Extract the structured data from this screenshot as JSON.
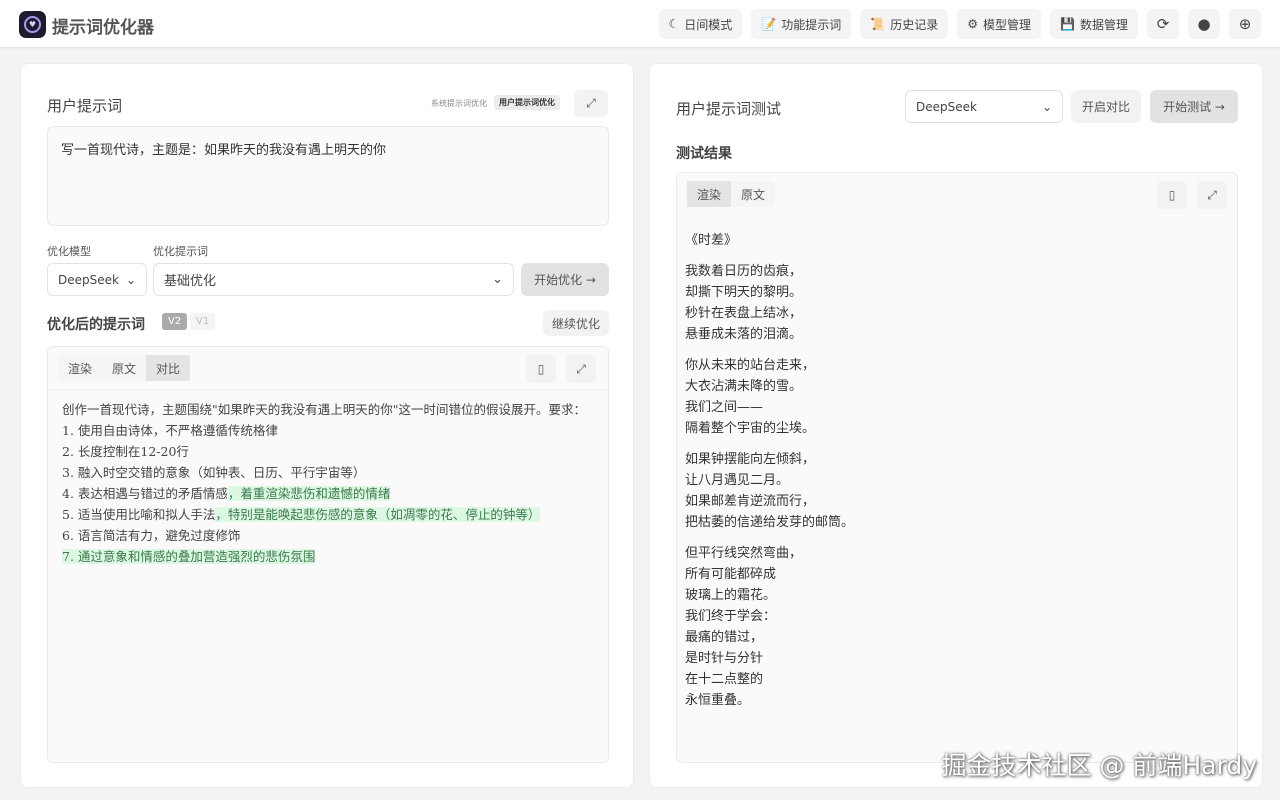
{
  "header": {
    "title": "提示词优化器",
    "nav": [
      {
        "icon": "moon-icon",
        "glyph": "☾",
        "label": "日间模式"
      },
      {
        "icon": "pencil-icon",
        "glyph": "📝",
        "label": "功能提示词"
      },
      {
        "icon": "scroll-icon",
        "glyph": "📜",
        "label": "历史记录"
      },
      {
        "icon": "gear-icon",
        "glyph": "⚙",
        "label": "模型管理"
      },
      {
        "icon": "floppy-icon",
        "glyph": "💾",
        "label": "数据管理"
      }
    ]
  },
  "left": {
    "title": "用户提示词",
    "mode_system": "系统提示词优化",
    "mode_user": "用户提示词优化",
    "input_value": "写一首现代诗，主题是：如果昨天的我没有遇上明天的你",
    "model_label": "优化模型",
    "model_value": "DeepSeek",
    "template_label": "优化提示词",
    "template_value": "基础优化",
    "optimize_button": "开始优化 →",
    "result_title": "优化后的提示词",
    "versions": [
      "V2",
      "V1"
    ],
    "continue_button": "继续优化",
    "tabs": [
      "渲染",
      "原文",
      "对比"
    ],
    "intro": "创作一首现代诗，主题围绕\"如果昨天的我没有遇上明天的你\"这一时间错位的假设展开。要求：",
    "items": [
      {
        "text": "1. 使用自由诗体，不严格遵循传统格律",
        "added": ""
      },
      {
        "text": "2. 长度控制在12-20行",
        "added": ""
      },
      {
        "text": "3. 融入时空交错的意象（如钟表、日历、平行宇宙等）",
        "added": ""
      },
      {
        "text": "4. 表达相遇与错过的矛盾情感",
        "added": "，着重渲染悲伤和遗憾的情绪"
      },
      {
        "text": "5. 适当使用比喻和拟人手法",
        "added": "，特别是能唤起悲伤感的意象（如凋零的花、停止的钟等）"
      },
      {
        "text": "6. 语言简洁有力，避免过度修饰",
        "added": ""
      },
      {
        "text": "",
        "added": "7. 通过意象和情感的叠加营造强烈的悲伤氛围"
      }
    ]
  },
  "right": {
    "title": "用户提示词测试",
    "model_value": "DeepSeek",
    "compare_button": "开启对比",
    "test_button": "开始测试 →",
    "result_title": "测试结果",
    "tabs": [
      "渲染",
      "原文"
    ],
    "poem_title": "《时差》",
    "stanzas": [
      [
        "我数着日历的齿痕，",
        "却撕下明天的黎明。",
        "秒针在表盘上结冰，",
        "悬垂成未落的泪滴。"
      ],
      [
        "你从未来的站台走来，",
        "大衣沾满未降的雪。",
        "我们之间——",
        "隔着整个宇宙的尘埃。"
      ],
      [
        "如果钟摆能向左倾斜，",
        "让八月遇见二月。",
        "如果邮差肯逆流而行，",
        "把枯萎的信递给发芽的邮筒。"
      ],
      [
        "但平行线突然弯曲，",
        "所有可能都碎成",
        "玻璃上的霜花。",
        "我们终于学会：",
        "最痛的错过，",
        "是时针与分针",
        "在十二点整的",
        "永恒重叠。"
      ]
    ]
  },
  "watermark": "掘金技术社区 @ 前端Hardy"
}
